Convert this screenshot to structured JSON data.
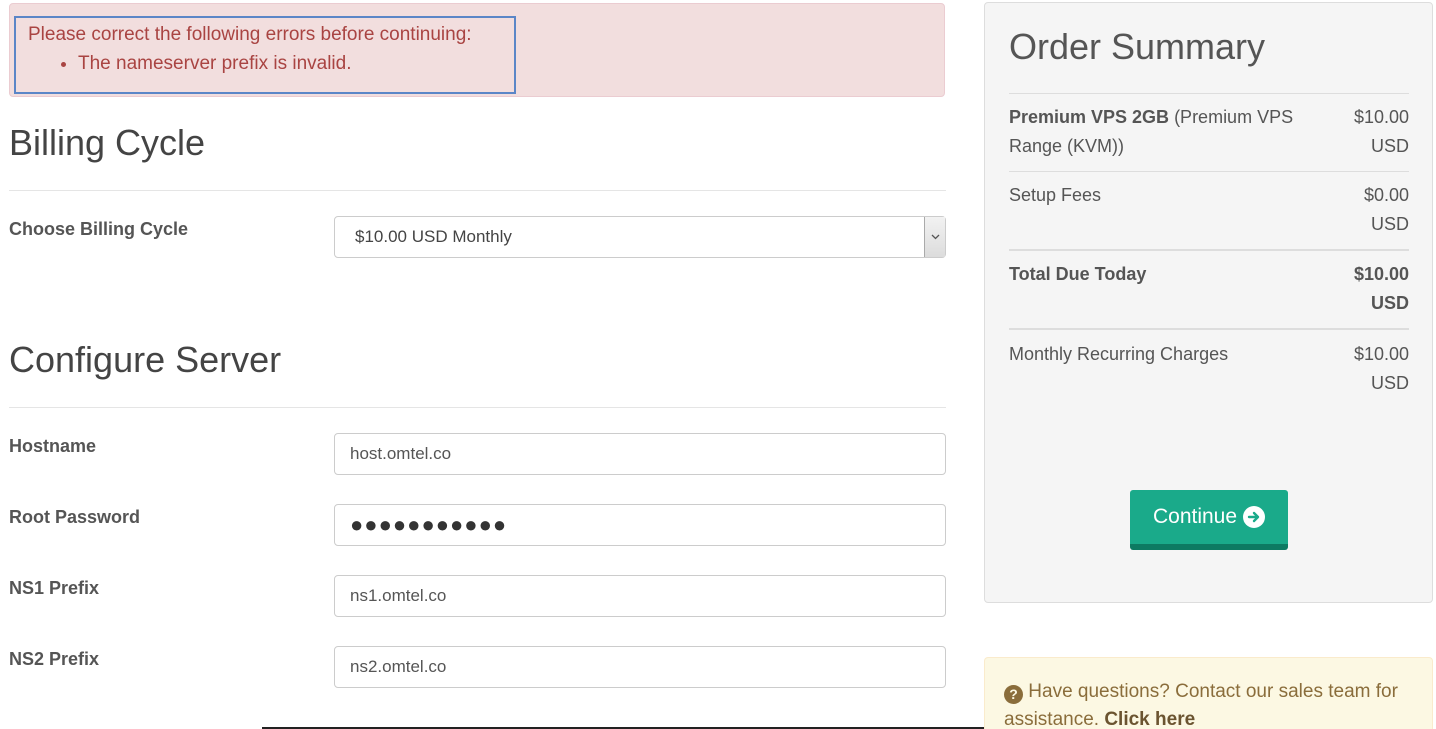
{
  "alert": {
    "heading": "Please correct the following errors before continuing:",
    "errors": [
      "The nameserver prefix is invalid."
    ]
  },
  "billing": {
    "title": "Billing Cycle",
    "label": "Choose Billing Cycle",
    "selected": "$10.00 USD Monthly"
  },
  "configure": {
    "title": "Configure Server",
    "hostname_label": "Hostname",
    "hostname_value": "host.omtel.co",
    "password_label": "Root Password",
    "password_masked": "●●●●●●●●●●●",
    "ns1_label": "NS1 Prefix",
    "ns1_value": "ns1.omtel.co",
    "ns2_label": "NS2 Prefix",
    "ns2_value": "ns2.omtel.co"
  },
  "summary": {
    "title": "Order Summary",
    "product_name": "Premium VPS 2GB",
    "product_group": " (Premium VPS Range (KVM))",
    "product_price_line1": "$10.00",
    "product_price_line2": "USD",
    "setup_label": "Setup Fees",
    "setup_price_line1": "$0.00",
    "setup_price_line2": "USD",
    "total_label": "Total Due Today",
    "total_price_line1": "$10.00",
    "total_price_line2": "USD",
    "recurring_label": "Monthly Recurring Charges",
    "recurring_price_line1": "$10.00",
    "recurring_price_line2": "USD",
    "continue_label": "Continue"
  },
  "questions": {
    "text": " Have questions? Contact our sales team for assistance. ",
    "link": "Click here"
  },
  "colors": {
    "accent": "#1aaa8a",
    "error_bg": "#f2dede",
    "error_text": "#a94442",
    "warning_bg": "#fcf8e3"
  }
}
